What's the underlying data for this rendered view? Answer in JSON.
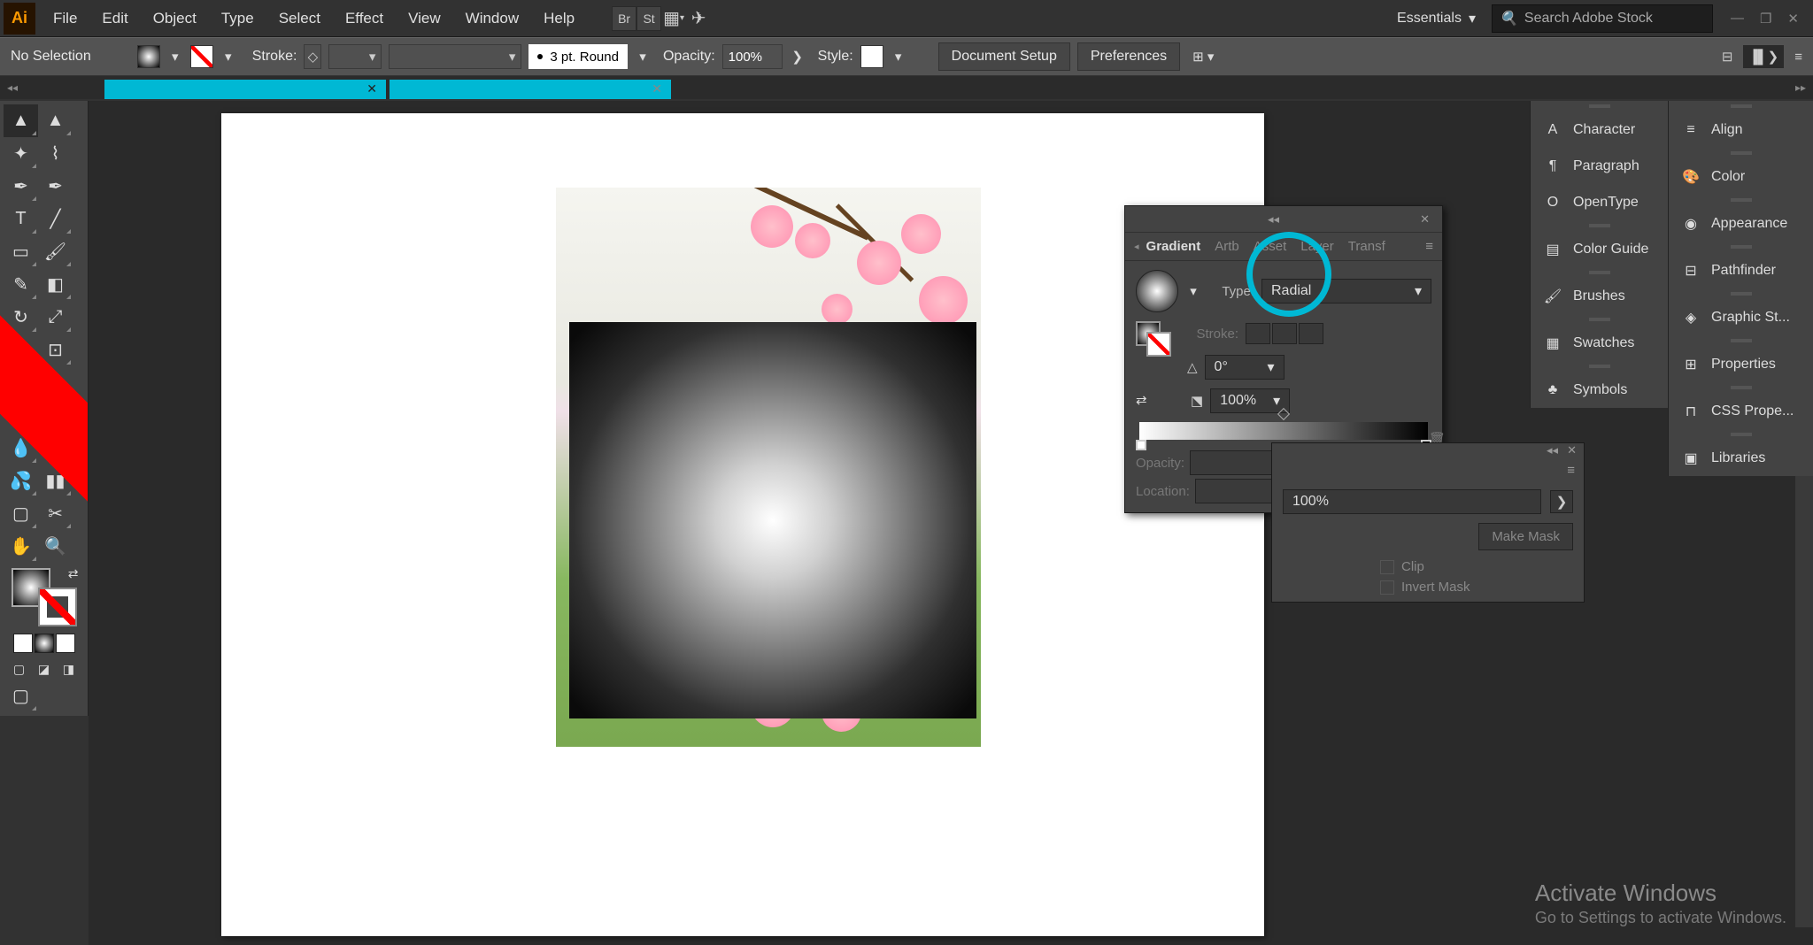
{
  "menubar": {
    "items": [
      "File",
      "Edit",
      "Object",
      "Type",
      "Select",
      "Effect",
      "View",
      "Window",
      "Help"
    ]
  },
  "workspace": {
    "name": "Essentials"
  },
  "search": {
    "placeholder": "Search Adobe Stock"
  },
  "controlbar": {
    "selection": "No Selection",
    "stroke_label": "Stroke:",
    "brush": "3 pt. Round",
    "opacity_label": "Opacity:",
    "opacity": "100%",
    "style_label": "Style:",
    "doc_setup": "Document Setup",
    "prefs": "Preferences"
  },
  "gradient_panel": {
    "tabs": [
      "Gradient",
      "Artb",
      "Asset",
      "Layer",
      "Transf"
    ],
    "type_label": "Type:",
    "type_value": "Radial",
    "stroke_label": "Stroke:",
    "angle": "0°",
    "aspect": "100%",
    "opacity_label": "Opacity:",
    "location_label": "Location:"
  },
  "transparency": {
    "opacity_value": "100%",
    "make_mask": "Make Mask",
    "clip": "Clip",
    "invert": "Invert Mask"
  },
  "right_panels_1": [
    "Character",
    "Paragraph",
    "OpenType",
    "Color Guide",
    "Brushes",
    "Swatches",
    "Symbols"
  ],
  "right_panels_2": [
    "Align",
    "Color",
    "Appearance",
    "Pathfinder",
    "Graphic St...",
    "Properties",
    "CSS Prope...",
    "Libraries"
  ],
  "activate": {
    "title": "Activate Windows",
    "sub": "Go to Settings to activate Windows."
  }
}
